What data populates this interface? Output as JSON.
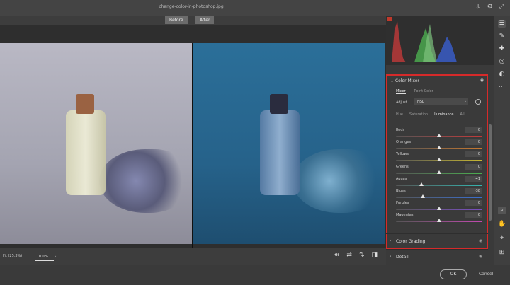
{
  "window": {
    "title": "change-color-in-photoshop.jpg"
  },
  "compare": {
    "before_label": "Before",
    "after_label": "After"
  },
  "statusbar": {
    "fit_label": "Fit (25.3%)",
    "zoom_value": "100%"
  },
  "color_mixer": {
    "title": "Color Mixer",
    "mode_tabs": [
      "Mixer",
      "Point Color"
    ],
    "adjust_label": "Adjust",
    "adjust_value": "HSL",
    "property_tabs": [
      "Hue",
      "Saturation",
      "Luminance",
      "All"
    ],
    "selected_property": "Luminance",
    "sliders": [
      {
        "label": "Reds",
        "value": "0",
        "pos": 0.5,
        "color": "#c23a3a"
      },
      {
        "label": "Oranges",
        "value": "0",
        "pos": 0.5,
        "color": "#c8782e"
      },
      {
        "label": "Yellows",
        "value": "0",
        "pos": 0.5,
        "color": "#c8b832"
      },
      {
        "label": "Greens",
        "value": "0",
        "pos": 0.5,
        "color": "#4caf50"
      },
      {
        "label": "Aquas",
        "value": "-41",
        "pos": 0.295,
        "color": "#35b6b0"
      },
      {
        "label": "Blues",
        "value": "-38",
        "pos": 0.31,
        "color": "#3a6fd0"
      },
      {
        "label": "Purples",
        "value": "0",
        "pos": 0.5,
        "color": "#7a4ec2"
      },
      {
        "label": "Magentas",
        "value": "0",
        "pos": 0.5,
        "color": "#c24ab0"
      }
    ]
  },
  "sections": [
    "Color Grading",
    "Detail"
  ],
  "buttons": {
    "ok": "OK",
    "cancel": "Cancel"
  },
  "colors": {
    "highlight_border": "#d62a2a",
    "after_tint": "#2b6f99"
  }
}
